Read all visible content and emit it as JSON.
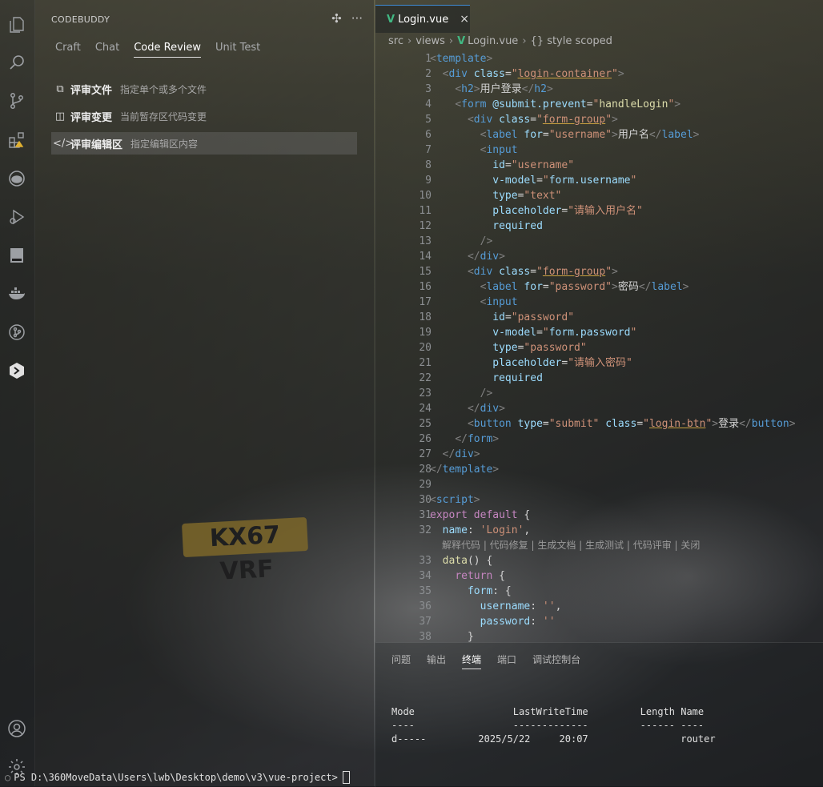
{
  "background": {
    "plate_text": "KX67 VRF"
  },
  "activity_bar": {
    "icons": [
      "explorer-icon",
      "search-icon",
      "source-control-icon",
      "extensions-icon",
      "copilot-icon",
      "run-debug-icon",
      "remote-icon",
      "docker-icon",
      "git-graph-icon",
      "codebuddy-icon",
      "account-icon",
      "settings-icon"
    ]
  },
  "sidebar": {
    "title": "CODEBUDDY",
    "actions": [
      "✣",
      "···"
    ],
    "tabs": [
      {
        "label": "Craft"
      },
      {
        "label": "Chat"
      },
      {
        "label": "Code Review"
      },
      {
        "label": "Unit Test"
      }
    ],
    "review_items": [
      {
        "icon": "⧉",
        "label": "评审文件",
        "desc": "指定单个或多个文件"
      },
      {
        "icon": "◫",
        "label": "评审变更",
        "desc": "当前暂存区代码变更"
      },
      {
        "icon": "</>",
        "label": "评审编辑区",
        "desc": "指定编辑区内容"
      }
    ]
  },
  "editor": {
    "tab": {
      "label": "Login.vue",
      "close": "×"
    },
    "breadcrumb": {
      "p1": "src",
      "p2": "views",
      "p3": "Login.vue",
      "p4": "{} style scoped"
    },
    "code_lens": "解释代码 | 代码修复 | 生成文档 | 生成测试 | 代码评审 | 关闭"
  },
  "panel": {
    "tabs": [
      "问题",
      "输出",
      "终端",
      "端口",
      "调试控制台"
    ],
    "terminal": {
      "header": "Mode                 LastWriteTime         Length Name",
      "dashes": "----                 -------------         ------ ----",
      "row": "d-----         2025/5/22     20:07                router",
      "prompt": "PS D:\\360MoveData\\Users\\lwb\\Desktop\\demo\\v3\\vue-project>"
    }
  }
}
